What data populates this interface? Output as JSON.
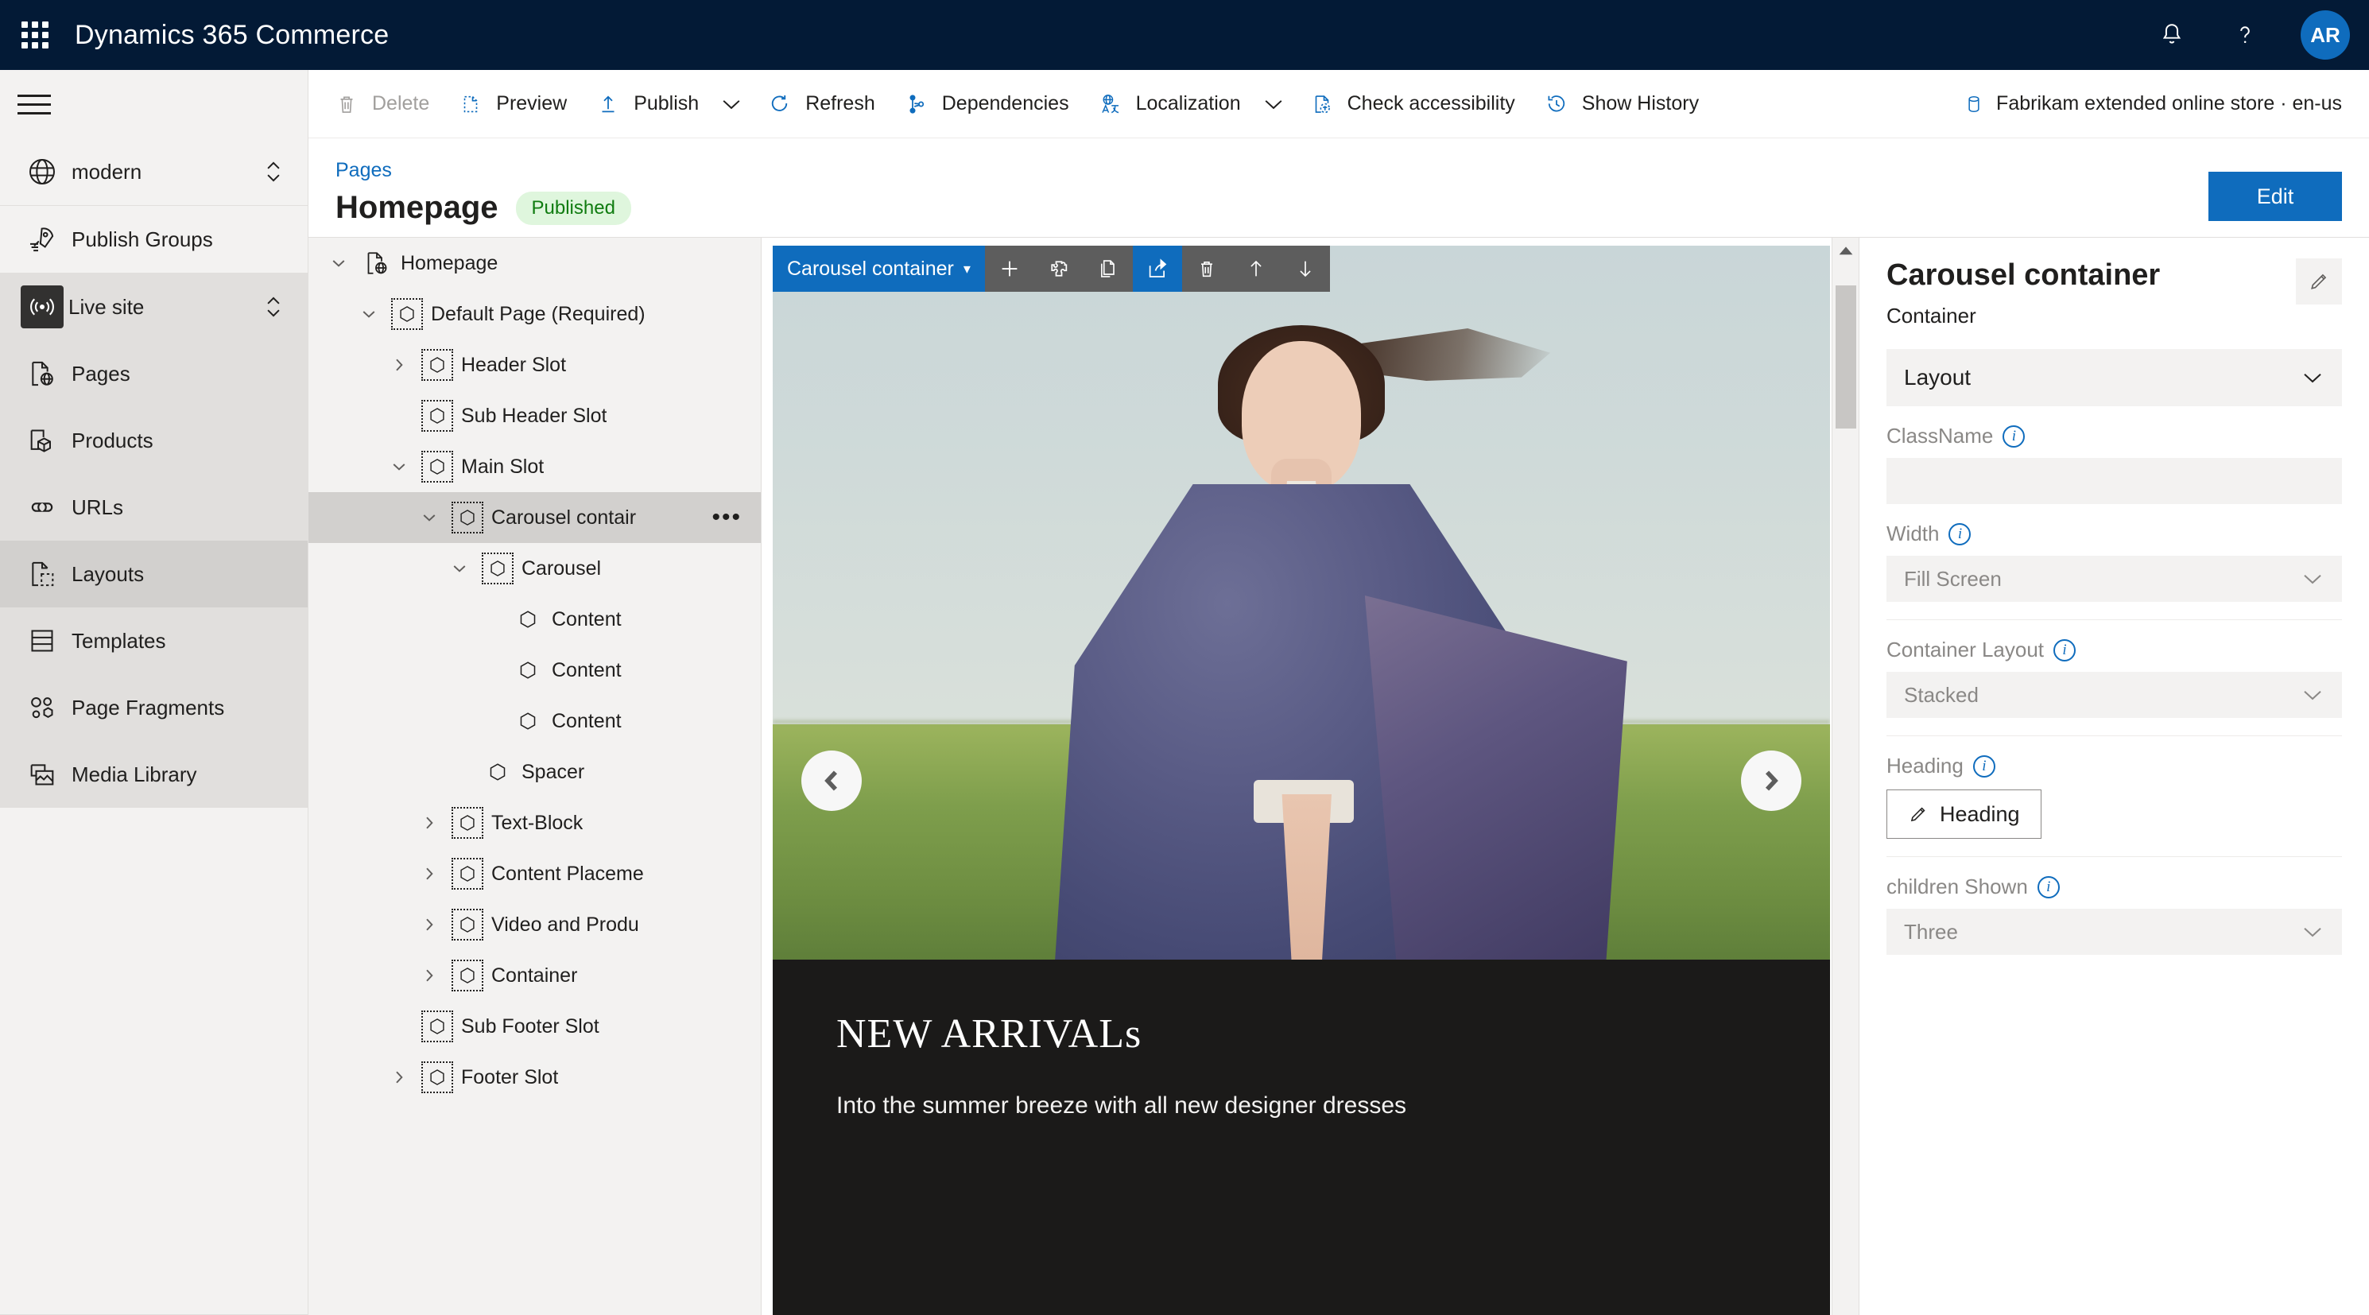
{
  "topnav": {
    "waffle_icon": "app-launcher-icon",
    "brand": "Dynamics 365 Commerce",
    "notifications_icon": "bell-icon",
    "help_icon": "question-mark-icon",
    "avatar_initials": "AR",
    "avatar_color": "#0f6cbd"
  },
  "sidebar": {
    "menu_icon": "hamburger-icon",
    "site_selector": {
      "label": "modern",
      "icon": "globe-icon",
      "chevron": "chevron-up-down-icon"
    },
    "items": [
      {
        "label": "Publish Groups",
        "icon": "rocket-icon",
        "state": "normal"
      },
      {
        "label": "Live site",
        "icon": "broadcast-icon",
        "state": "active",
        "chevron": "chevron-up-down-icon"
      },
      {
        "label": "Pages",
        "icon": "page-web-icon",
        "state": "normal"
      },
      {
        "label": "Products",
        "icon": "product-box-icon",
        "state": "normal"
      },
      {
        "label": "URLs",
        "icon": "link-icon",
        "state": "normal"
      },
      {
        "label": "Layouts",
        "icon": "layout-page-icon",
        "state": "hover"
      },
      {
        "label": "Templates",
        "icon": "template-icon",
        "state": "normal"
      },
      {
        "label": "Page Fragments",
        "icon": "fragments-icon",
        "state": "normal"
      },
      {
        "label": "Media Library",
        "icon": "media-image-icon",
        "state": "normal"
      }
    ]
  },
  "commandbar": {
    "items": [
      {
        "label": "Delete",
        "icon": "trash-icon",
        "disabled": true
      },
      {
        "label": "Preview",
        "icon": "preview-page-icon",
        "disabled": false
      },
      {
        "label": "Publish",
        "icon": "publish-upload-icon",
        "disabled": false,
        "has_caret": true
      },
      {
        "label": "Refresh",
        "icon": "refresh-icon",
        "disabled": false
      },
      {
        "label": "Dependencies",
        "icon": "dependencies-icon",
        "disabled": false
      },
      {
        "label": "Localization",
        "icon": "localization-globe-icon",
        "disabled": false,
        "has_caret": true
      },
      {
        "label": "Check accessibility",
        "icon": "accessibility-check-icon",
        "disabled": false
      },
      {
        "label": "Show History",
        "icon": "history-clock-icon",
        "disabled": false
      }
    ],
    "store": {
      "label": "Fabrikam extended online store · en-us",
      "icon": "database-icon"
    }
  },
  "page": {
    "breadcrumb": "Pages",
    "title": "Homepage",
    "status_badge": "Published",
    "status_badge_color": "#107c10",
    "edit_button": "Edit"
  },
  "tree": {
    "nodes": [
      {
        "label": "Homepage",
        "indent": 0,
        "twist": "down",
        "icon": "page-web-icon",
        "selected": false
      },
      {
        "label": "Default Page (Required)",
        "indent": 1,
        "twist": "down",
        "icon": "module-slot-icon",
        "selected": false
      },
      {
        "label": "Header Slot",
        "indent": 2,
        "twist": "right",
        "icon": "module-slot-icon",
        "selected": false
      },
      {
        "label": "Sub Header Slot",
        "indent": 2,
        "twist": "none",
        "icon": "module-slot-icon",
        "selected": false
      },
      {
        "label": "Main Slot",
        "indent": 2,
        "twist": "down",
        "icon": "module-slot-icon",
        "selected": false
      },
      {
        "label": "Carousel contair",
        "indent": 3,
        "twist": "down",
        "icon": "module-slot-icon",
        "selected": true,
        "more": "•••"
      },
      {
        "label": "Carousel",
        "indent": 4,
        "twist": "down",
        "icon": "module-slot-icon",
        "selected": false
      },
      {
        "label": "Content",
        "indent": 5,
        "twist": "none",
        "icon": "module-leaf-icon",
        "selected": false
      },
      {
        "label": "Content",
        "indent": 5,
        "twist": "none",
        "icon": "module-leaf-icon",
        "selected": false
      },
      {
        "label": "Content",
        "indent": 5,
        "twist": "none",
        "icon": "module-leaf-icon",
        "selected": false
      },
      {
        "label": "Spacer",
        "indent": 4,
        "twist": "none",
        "icon": "module-leaf-icon",
        "selected": false
      },
      {
        "label": "Text-Block",
        "indent": 3,
        "twist": "right",
        "icon": "module-slot-icon",
        "selected": false
      },
      {
        "label": "Content Placeme",
        "indent": 3,
        "twist": "right",
        "icon": "module-slot-icon",
        "selected": false
      },
      {
        "label": "Video and Produ",
        "indent": 3,
        "twist": "right",
        "icon": "module-slot-icon",
        "selected": false
      },
      {
        "label": "Container",
        "indent": 3,
        "twist": "right",
        "icon": "module-slot-icon",
        "selected": false
      },
      {
        "label": "Sub Footer Slot",
        "indent": 2,
        "twist": "none",
        "icon": "module-slot-icon",
        "selected": false
      },
      {
        "label": "Footer Slot",
        "indent": 2,
        "twist": "right",
        "icon": "module-slot-icon",
        "selected": false
      }
    ]
  },
  "canvas": {
    "module_toolbar": {
      "label": "Carousel container",
      "caret": "▾",
      "tools": [
        {
          "icon": "add-icon",
          "active": false
        },
        {
          "icon": "module-icon",
          "active": false
        },
        {
          "icon": "copy-icon",
          "active": false
        },
        {
          "icon": "move-out-icon",
          "active": true
        },
        {
          "icon": "delete-icon",
          "active": false
        },
        {
          "icon": "move-up-icon",
          "active": false
        },
        {
          "icon": "move-down-icon",
          "active": false
        }
      ]
    },
    "carousel": {
      "prev_icon": "chevron-left-icon",
      "next_icon": "chevron-right-icon",
      "caption_title": "NEW ARRIVALs",
      "caption_subtitle": "Into the summer breeze with all new designer dresses",
      "caption_background": "#1b1a19"
    },
    "scrollbar": {
      "up_icon": "scroll-up-arrow-icon"
    }
  },
  "properties": {
    "title": "Carousel container",
    "subtitle": "Container",
    "edit_icon": "pencil-icon",
    "accordion": {
      "label": "Layout",
      "chevron": "chevron-down-icon"
    },
    "fields": [
      {
        "name": "ClassName",
        "type": "text",
        "value": "",
        "info": "info-icon"
      },
      {
        "name": "Width",
        "type": "select",
        "value": "Fill Screen",
        "info": "info-icon"
      },
      {
        "name": "Container Layout",
        "type": "select",
        "value": "Stacked",
        "info": "info-icon"
      },
      {
        "name": "Heading",
        "type": "button",
        "value": "Heading",
        "info": "info-icon",
        "button_icon": "pencil-icon"
      },
      {
        "name": "children Shown",
        "type": "select",
        "value": "Three",
        "info": "info-icon"
      }
    ]
  }
}
